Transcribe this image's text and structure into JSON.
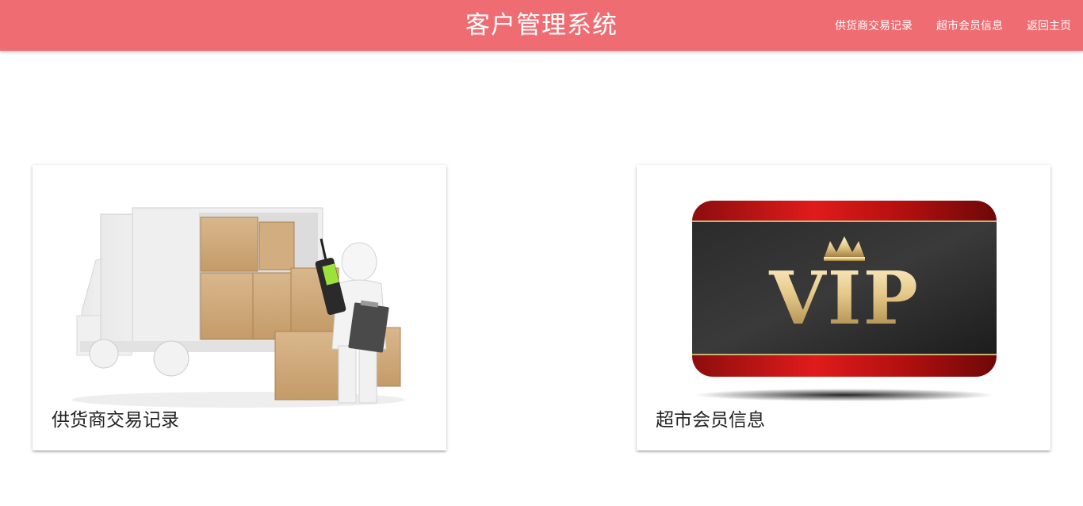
{
  "header": {
    "title": "客户管理系统",
    "nav": [
      {
        "label": "供货商交易记录"
      },
      {
        "label": "超市会员信息"
      },
      {
        "label": "返回主页"
      }
    ]
  },
  "cards": [
    {
      "title": "供货商交易记录",
      "image_icon": "delivery-truck-illustration"
    },
    {
      "title": "超市会员信息",
      "image_icon": "vip-card-illustration",
      "image_text": "VIP"
    }
  ],
  "colors": {
    "header_bg": "#ef6c72",
    "header_text": "#ffffff",
    "card_title": "#222222",
    "vip_red": "#c81818",
    "vip_gold": "#e6c98a"
  }
}
